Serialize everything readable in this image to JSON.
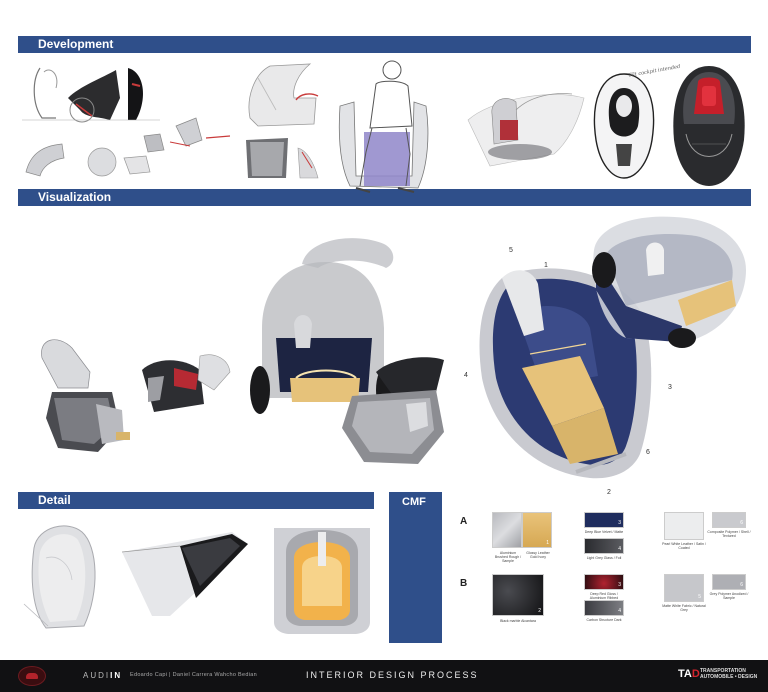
{
  "sections": {
    "development": "Development",
    "visualization": "Visualization",
    "detail": "Detail",
    "cmf": "CMF"
  },
  "sketch_note": "Tilt cockpit intended",
  "callouts": [
    "5",
    "1",
    "4",
    "3",
    "6",
    "2"
  ],
  "cmf": {
    "row_a": "A",
    "row_b": "B",
    "swatch_numbers": [
      "1",
      "2",
      "3",
      "4",
      "5",
      "6",
      "1",
      "2",
      "3",
      "4",
      "5",
      "6"
    ],
    "captions": {
      "a1": "Aluminium Brushed Rough / Sample",
      "a2": "Glossy Leather Gold Ivory",
      "a3": "Deep Blue Velvet / Matte",
      "a4": "Light Grey Glass / Foil",
      "a5": "Pearl White Leather / Satin / Coated",
      "a6": "Composite Polymer / Shell / Textured",
      "b1": "Black marble Alcantara",
      "b2": "Deep Red Gloss / Aluminium Ribbed",
      "b3": "Carbon Structure Dark",
      "b4": "Matte White Fabric / Natural Grey",
      "b5": "Grey Polymer Anodized / Sample"
    }
  },
  "footer": {
    "brand_a": "AUDI",
    "brand_b": "IN",
    "names": "Edoardo Capi  |  Daniel Carrerа Wahcho Bedian",
    "title": "INTERIOR DESIGN PROCESS",
    "tad_a": "TA",
    "tad_b": "D",
    "tad_sub_1": "TRANSPORTATION",
    "tad_sub_2": "AUTOMOBILE • DESIGN"
  },
  "colors": {
    "band": "#2f4f8a",
    "footer": "#111113",
    "accent_red": "#b3232b",
    "gold": "#e6c27a",
    "navy": "#263a6e"
  }
}
